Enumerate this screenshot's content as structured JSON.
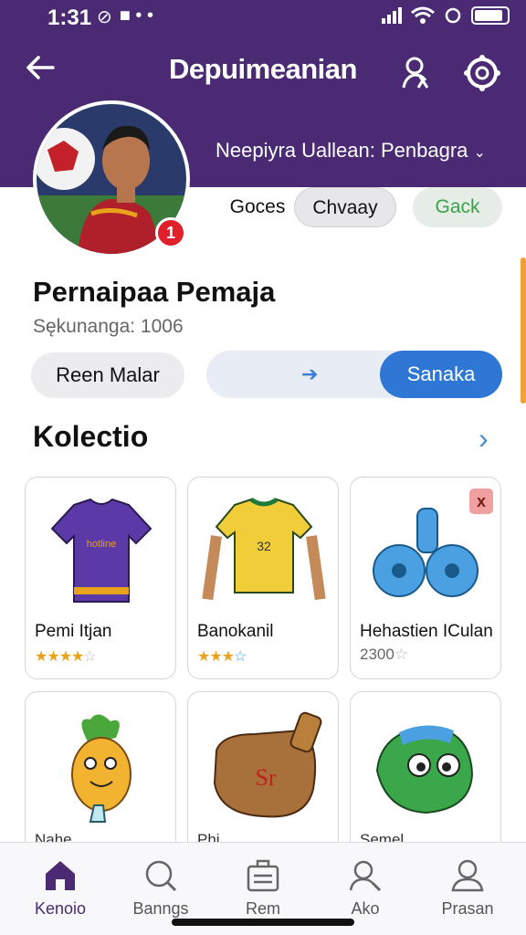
{
  "status": {
    "time": "1:31"
  },
  "header": {
    "title": "Depuimeanian",
    "subtitle": "Neepiyra Uallean: Penbagra"
  },
  "avatar": {
    "badge": "1"
  },
  "chips": [
    "Goces",
    "Chvaay",
    "Gack"
  ],
  "profile": {
    "name": "Pernaipaa Pemaja",
    "meta": "Sękunanga: 1006"
  },
  "actions": {
    "grey_label": "Reen Malar",
    "blue_label": "Sanaka"
  },
  "collection": {
    "title": "Kolectio",
    "items": [
      {
        "title": "Pemi Itjan",
        "rating": 3.5
      },
      {
        "title": "Banokanil",
        "rating": 3
      },
      {
        "title": "Hehastien ICulan",
        "sub": "2300",
        "close": "x"
      },
      {
        "title": "Nahe..."
      },
      {
        "title": "Phi..."
      },
      {
        "title": "Semel"
      }
    ]
  },
  "tabs": [
    {
      "label": "Kenoio",
      "icon": "home-icon",
      "active": true
    },
    {
      "label": "Banngs",
      "icon": "search-icon"
    },
    {
      "label": "Rem",
      "icon": "inbox-icon"
    },
    {
      "label": "Ako",
      "icon": "user-search-icon"
    },
    {
      "label": "Prasan",
      "icon": "profile-icon"
    }
  ],
  "colors": {
    "header": "#4a2a73",
    "accent": "#2f77d4",
    "green": "#3aa24a"
  }
}
